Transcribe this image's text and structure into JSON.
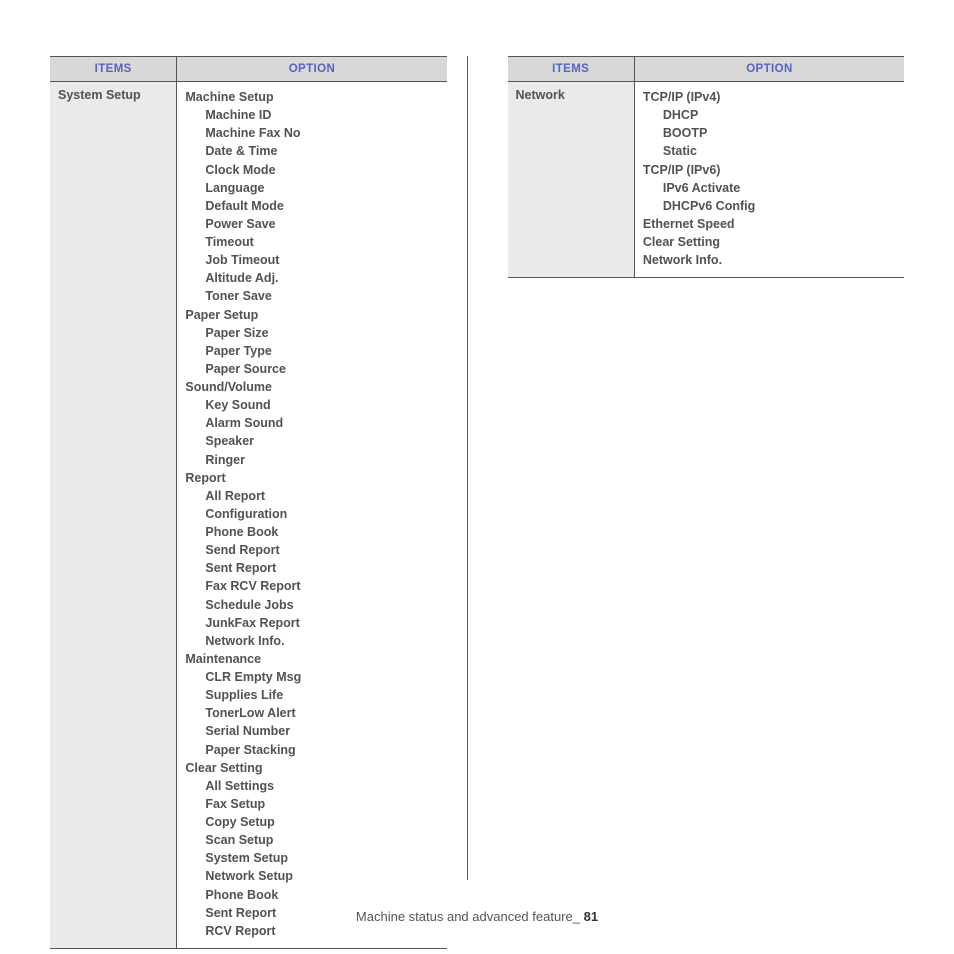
{
  "headers": {
    "items": "ITEMS",
    "option": "OPTION"
  },
  "left": {
    "item": "System Setup",
    "options": [
      {
        "t": "Machine Setup",
        "l": 0
      },
      {
        "t": "Machine ID",
        "l": 1
      },
      {
        "t": "Machine Fax No",
        "l": 1
      },
      {
        "t": "Date & Time",
        "l": 1
      },
      {
        "t": "Clock Mode",
        "l": 1
      },
      {
        "t": "Language",
        "l": 1
      },
      {
        "t": "Default Mode",
        "l": 1
      },
      {
        "t": "Power Save",
        "l": 1
      },
      {
        "t": "Timeout",
        "l": 1
      },
      {
        "t": "Job Timeout",
        "l": 1
      },
      {
        "t": "Altitude Adj.",
        "l": 1
      },
      {
        "t": "Toner Save",
        "l": 1
      },
      {
        "t": "Paper Setup",
        "l": 0
      },
      {
        "t": "Paper Size",
        "l": 1
      },
      {
        "t": "Paper Type",
        "l": 1
      },
      {
        "t": "Paper Source",
        "l": 1
      },
      {
        "t": "Sound/Volume",
        "l": 0
      },
      {
        "t": "Key Sound",
        "l": 1
      },
      {
        "t": "Alarm Sound",
        "l": 1
      },
      {
        "t": "Speaker",
        "l": 1
      },
      {
        "t": "Ringer",
        "l": 1
      },
      {
        "t": "Report",
        "l": 0
      },
      {
        "t": "All Report",
        "l": 1
      },
      {
        "t": "Configuration",
        "l": 1
      },
      {
        "t": "Phone Book",
        "l": 1
      },
      {
        "t": "Send Report",
        "l": 1
      },
      {
        "t": "Sent Report",
        "l": 1
      },
      {
        "t": "Fax RCV Report",
        "l": 1
      },
      {
        "t": "Schedule Jobs",
        "l": 1
      },
      {
        "t": "JunkFax Report",
        "l": 1
      },
      {
        "t": "Network Info.",
        "l": 1
      },
      {
        "t": "Maintenance",
        "l": 0
      },
      {
        "t": "CLR Empty Msg",
        "l": 1
      },
      {
        "t": "Supplies Life",
        "l": 1
      },
      {
        "t": "TonerLow Alert",
        "l": 1
      },
      {
        "t": "Serial Number",
        "l": 1
      },
      {
        "t": "Paper Stacking",
        "l": 1
      },
      {
        "t": "Clear Setting",
        "l": 0
      },
      {
        "t": "All Settings",
        "l": 1
      },
      {
        "t": "Fax Setup",
        "l": 1
      },
      {
        "t": "Copy Setup",
        "l": 1
      },
      {
        "t": "Scan Setup",
        "l": 1
      },
      {
        "t": "System Setup",
        "l": 1
      },
      {
        "t": "Network Setup",
        "l": 1
      },
      {
        "t": "Phone Book",
        "l": 1
      },
      {
        "t": "Sent Report",
        "l": 1
      },
      {
        "t": "RCV Report",
        "l": 1
      }
    ]
  },
  "right": {
    "item": "Network",
    "options": [
      {
        "t": "TCP/IP (IPv4)",
        "l": 0
      },
      {
        "t": "DHCP",
        "l": 1
      },
      {
        "t": "BOOTP",
        "l": 1
      },
      {
        "t": "Static",
        "l": 1
      },
      {
        "t": "TCP/IP (IPv6)",
        "l": 0
      },
      {
        "t": "IPv6 Activate",
        "l": 1
      },
      {
        "t": "DHCPv6 Config",
        "l": 1
      },
      {
        "t": "Ethernet Speed",
        "l": 0
      },
      {
        "t": "Clear Setting",
        "l": 0
      },
      {
        "t": "Network Info.",
        "l": 0
      }
    ]
  },
  "footer": {
    "text": "Machine status and advanced feature_",
    "page": "81"
  }
}
